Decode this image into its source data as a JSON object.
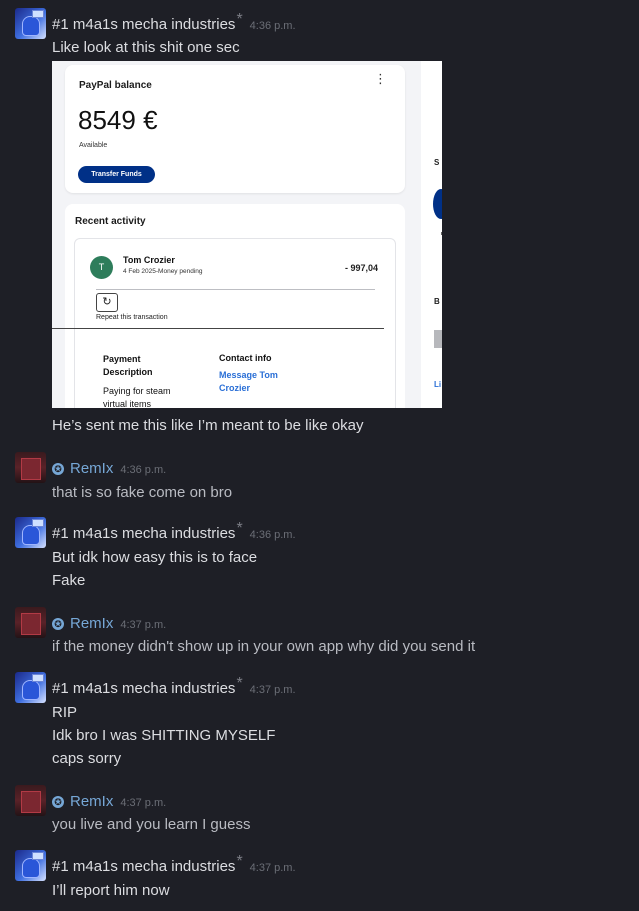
{
  "messages": [
    {
      "author": "#1 m4a1s mecha industries",
      "time": "4:36 p.m.",
      "lines": [
        "Like look at this shit one sec"
      ]
    },
    {
      "after_image": "He’s sent me this like I’m meant to be like okay"
    },
    {
      "author": "RemIx",
      "time": "4:36 p.m.",
      "lines": [
        "that is so fake come on bro"
      ]
    },
    {
      "author": "#1 m4a1s mecha industries",
      "time": "4:36 p.m.",
      "lines": [
        "But idk how easy this is to face",
        "Fake"
      ]
    },
    {
      "author": "RemIx",
      "time": "4:37 p.m.",
      "lines": [
        "if the money didn't show up in your own app why did you send it"
      ]
    },
    {
      "author": "#1 m4a1s mecha industries",
      "time": "4:37 p.m.",
      "lines": [
        "RIP",
        "Idk bro I was SHITTING MYSELF",
        "caps sorry"
      ]
    },
    {
      "author": "RemIx",
      "time": "4:37 p.m.",
      "lines": [
        "you live and you learn I guess"
      ]
    },
    {
      "author": "#1 m4a1s mecha industries",
      "time": "4:37 p.m.",
      "lines": [
        "I’ll report him now"
      ]
    }
  ],
  "shot": {
    "card_title": "PayPal balance",
    "amount": "8549 €",
    "available": "Available",
    "transfer": "Transfer Funds",
    "recent": "Recent activity",
    "tx_initial": "T",
    "tx_name": "Tom Crozier",
    "tx_sub": "4 Feb 2025-Money pending",
    "tx_amount": "- 997,04",
    "repeat": "Repeat this transaction",
    "payment_heading": "Payment Description",
    "payment_text": "Paying for steam virtual items",
    "contact_heading": "Contact info",
    "contact_link": "Message Tom Crozier",
    "rc_s": "S",
    "rc_b": "B",
    "rc_l": "Li"
  },
  "icons": {
    "asterisk": "*",
    "remix_badge": "✪",
    "refresh": "↻",
    "kebab": "⋮"
  }
}
